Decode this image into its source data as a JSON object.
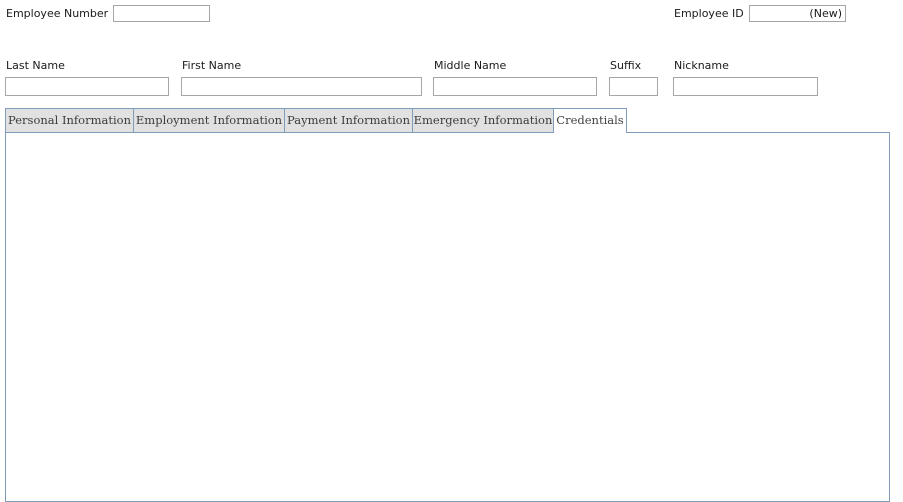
{
  "header": {
    "employee_number_label": "Employee Number",
    "employee_number_value": "",
    "employee_id_label": "Employee ID",
    "employee_id_value": "(New)"
  },
  "name_fields": {
    "last_name_label": "Last Name",
    "last_name_value": "",
    "first_name_label": "First Name",
    "first_name_value": "",
    "middle_name_label": "Middle Name",
    "middle_name_value": "",
    "suffix_label": "Suffix",
    "suffix_value": "",
    "nickname_label": "Nickname",
    "nickname_value": ""
  },
  "tabs": [
    {
      "label": "Personal Information",
      "active": false
    },
    {
      "label": "Employment Information",
      "active": false
    },
    {
      "label": "Payment Information",
      "active": false
    },
    {
      "label": "Emergency Information",
      "active": false
    },
    {
      "label": "Credentials",
      "active": true
    }
  ]
}
